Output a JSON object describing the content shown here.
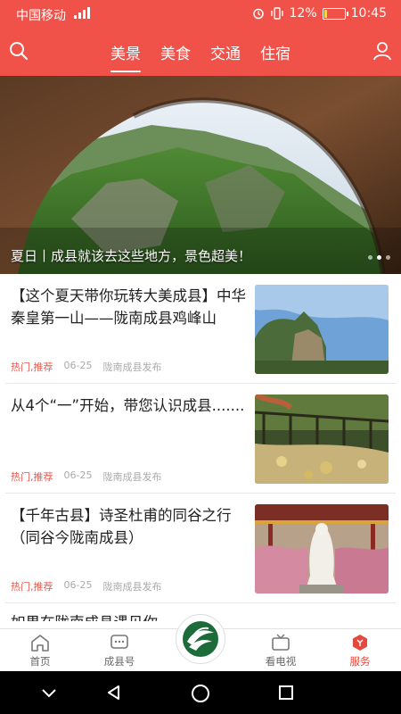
{
  "status_bar": {
    "carrier": "中国移动",
    "battery": "12%",
    "time": "10:45"
  },
  "header": {
    "tabs": [
      {
        "label": "美景",
        "active": true
      },
      {
        "label": "美食",
        "active": false
      },
      {
        "label": "交通",
        "active": false
      },
      {
        "label": "住宿",
        "active": false
      }
    ]
  },
  "banner": {
    "caption": "夏日丨成县就该去这些地方，景色超美！"
  },
  "articles": [
    {
      "title": "【这个夏天带你玩转大美成县】中华秦皇第一山——陇南成县鸡峰山",
      "tag": "热门,推荐",
      "date": "06-25",
      "source": "陇南成县发布"
    },
    {
      "title": "从4个“一”开始，带您认识成县.......",
      "tag": "热门,推荐",
      "date": "06-25",
      "source": "陇南成县发布"
    },
    {
      "title": "【千年古县】诗圣杜甫的同谷之行（同谷今陇南成县）",
      "tag": "热门,推荐",
      "date": "06-25",
      "source": "陇南成县发布"
    }
  ],
  "partial_article": {
    "title": "如果在陇南成县遇见你"
  },
  "bottom_nav": {
    "items": [
      {
        "label": "首页",
        "icon": "home-icon"
      },
      {
        "label": "成县号",
        "icon": "chat-icon"
      },
      {
        "label": "看电视",
        "icon": "tv-icon"
      },
      {
        "label": "服务",
        "icon": "service-icon",
        "active": true
      }
    ]
  },
  "colors": {
    "brand_red": "#f0524a",
    "tag_red": "#e85a4f",
    "active_tab": "#e24a3f"
  }
}
